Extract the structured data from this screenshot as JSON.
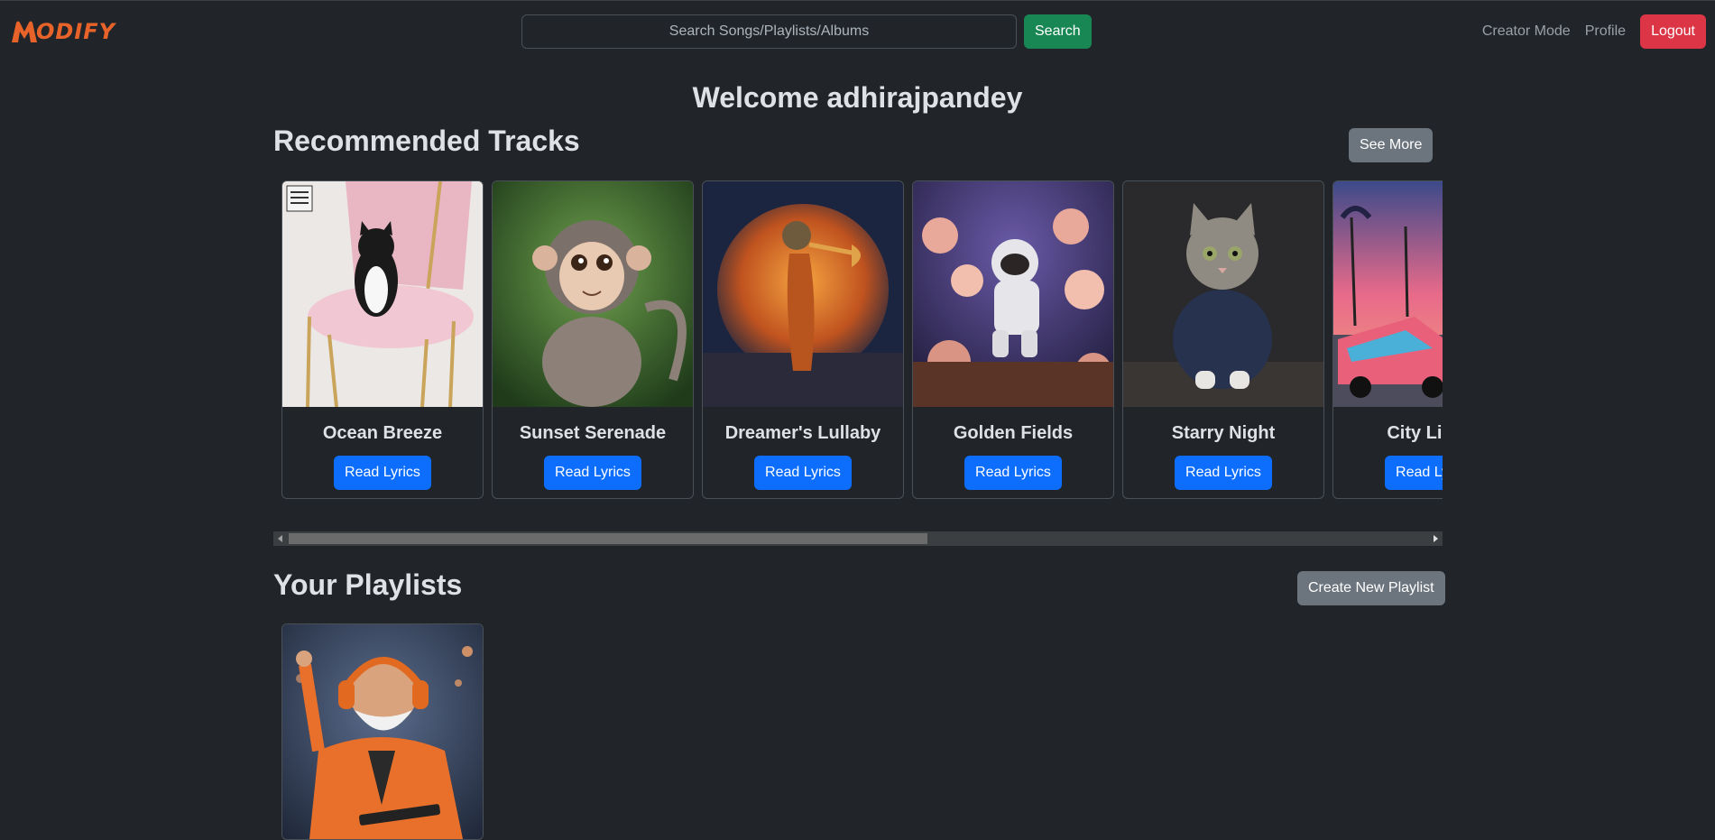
{
  "header": {
    "logo_text": "ODIFY",
    "search": {
      "placeholder": "Search Songs/Playlists/Albums",
      "value": "",
      "button_label": "Search"
    },
    "nav": {
      "creator_mode": "Creator Mode",
      "profile": "Profile",
      "logout": "Logout"
    }
  },
  "main": {
    "welcome": "Welcome adhirajpandey",
    "recommended": {
      "title": "Recommended Tracks",
      "see_more_label": "See More",
      "tracks": [
        {
          "title": "Ocean Breeze",
          "button": "Read Lyrics",
          "art": "cat-on-pink-chair"
        },
        {
          "title": "Sunset Serenade",
          "button": "Read Lyrics",
          "art": "monkey"
        },
        {
          "title": "Dreamer's Lullaby",
          "button": "Read Lyrics",
          "art": "meerkat-trumpet"
        },
        {
          "title": "Golden Fields",
          "button": "Read Lyrics",
          "art": "astronaut-flowers"
        },
        {
          "title": "Starry Night",
          "button": "Read Lyrics",
          "art": "cat-in-hoodie"
        },
        {
          "title": "City Lights",
          "button": "Read Lyrics",
          "art": "retro-car-palms"
        }
      ],
      "scroll_position": 0.0
    },
    "playlists": {
      "title": "Your Playlists",
      "create_label": "Create New Playlist",
      "items": [
        {
          "art": "man-with-headphones"
        }
      ]
    }
  },
  "colors": {
    "background": "#212529",
    "accent_logo": "#e8632a",
    "search_button": "#198754",
    "logout_button": "#dc3545",
    "primary_button": "#0d6efd",
    "secondary_button": "#6c757d"
  }
}
